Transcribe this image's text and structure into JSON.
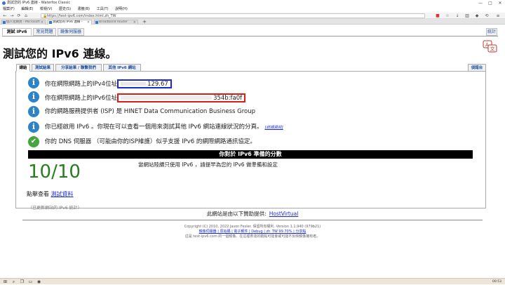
{
  "window": {
    "title": "測試您的 IPv6 連線 - Waterfox Classic",
    "minimize": "—",
    "maximize": "□",
    "close": "✕"
  },
  "menu": [
    "檔案(F)",
    "編輯(E)",
    "檢視(V)",
    "歷史(S)",
    "書籤(B)",
    "工具(T)",
    "說明(H)"
  ],
  "browser": {
    "url": "https://test-ipv6.com/index.html.zh_TW",
    "tabs": [
      {
        "label": "個人化網頁 - Microsoft"
      },
      {
        "label": "測試您的 IPv6 連線 -"
      },
      {
        "label": "Broadband Router"
      }
    ],
    "new_tab": "+",
    "back": "←",
    "forward": "→",
    "reload": "⟳",
    "home": "⌂",
    "menu_icon": "≡"
  },
  "site_tabs": {
    "test": "測試 IPv6",
    "faq": "常見問題",
    "mirrors": "鏡像伺服器",
    "stats": "統計"
  },
  "page_title": "測試您的 IPv6 連線。",
  "inner_tabs": {
    "summary": "總結",
    "results": "測試結果",
    "share": "分享結果 / 聯繫我們",
    "other": "其他 IPv6 網站",
    "debug": "偵錯台"
  },
  "rows": {
    "ipv4_label": "你在網際網路上的IPv4位址",
    "ipv4_value": "129.67",
    "ipv6_label": "你在網際網路上的IPv6位址",
    "ipv6_value": "354b:fa0f",
    "isp": "你的網路服務提供者 (ISP) 是 HINET Data Communication Business Group",
    "ipv6_enabled": "你已經啟用 IPv6 。你現在可以查看一個用來測試其他 IPv6 網站連線狀況的分頁。",
    "details_link": "[詳細資訊]",
    "dns": "你的 DNS 伺服器 （可能由你的ISP維護）似乎支援 IPv6 的網際網路通訊協定。"
  },
  "score": {
    "header": "你對於 IPv6 準備的分數",
    "value": "10/10",
    "description": "當網站陸續只使用 IPv6 ，請提早為您的 IPv6 做準備和設定"
  },
  "see_test": {
    "prefix": "點擊查看",
    "link": "測試資料"
  },
  "stats_note": "（已更新網站的 IPv6 統計）",
  "sponsor": {
    "label": "此網站是由以下贊助提供:",
    "link": "HostVirtual"
  },
  "footer": {
    "copyright": "Copyright (C) 2010, 2022 Jason Fesler. 保留所有權利. Version 1.1.940 (979b21)",
    "links": "鏡像伺服器 | 原始碼 | 電子郵件 | Debug | zh_TW 99.70% | 分享點",
    "note": "這是 test-ipv6.com 的一個鏡像。在這裡表達的觀點可能會或可能不反映鏡像擁有者。"
  },
  "taskbar": {
    "clock": "00:53"
  }
}
